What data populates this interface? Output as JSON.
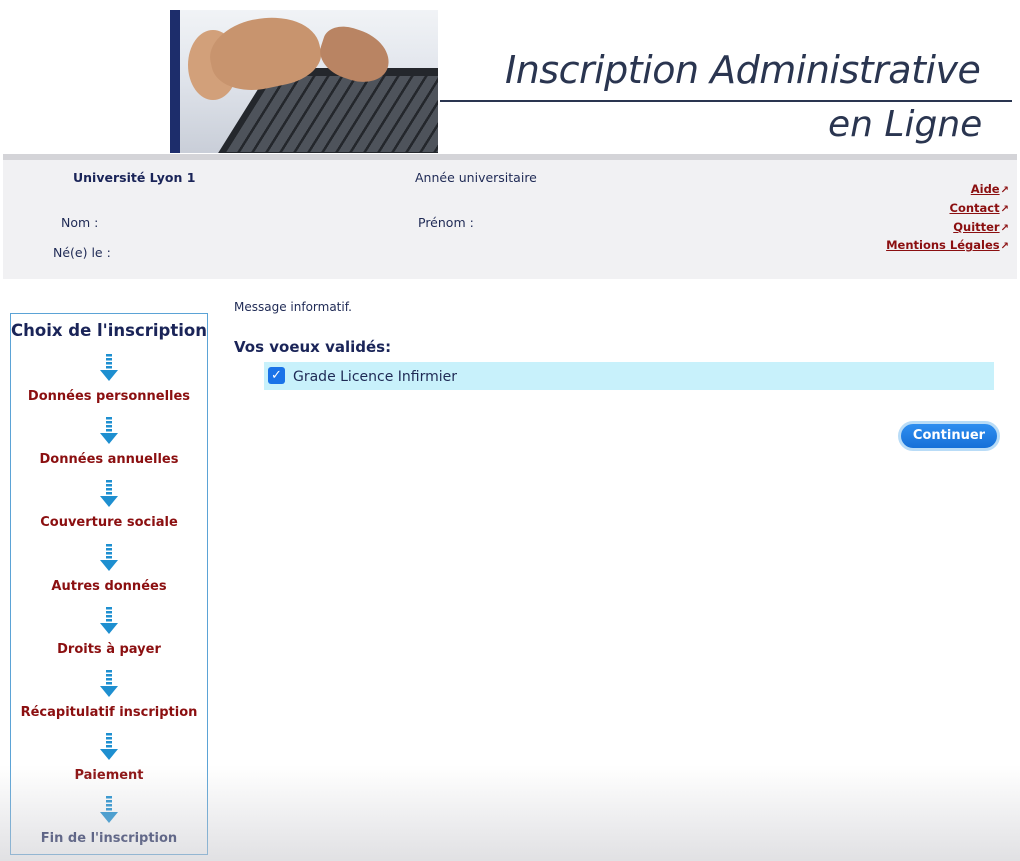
{
  "banner": {
    "title_line1": "Inscription Administrative",
    "title_line2": "en Ligne"
  },
  "info": {
    "university": "Université Lyon 1",
    "annee_label": "Année universitaire",
    "nom_label": "Nom :",
    "prenom_label": "Prénom :",
    "ne_le_label": "Né(e) le :"
  },
  "links": {
    "aide": "Aide",
    "contact": "Contact",
    "quitter": "Quitter",
    "mentions": "Mentions Légales",
    "external_glyph": "↗"
  },
  "sidebar": {
    "title": "Choix de l'inscription",
    "steps": [
      "Données personnelles",
      "Données annuelles",
      "Couverture sociale",
      "Autres données",
      "Droits à payer",
      "Récapitulatif inscription",
      "Paiement",
      "Fin de l'inscription"
    ]
  },
  "main": {
    "message": "Message informatif.",
    "voeux_heading": "Vos voeux validés:",
    "voeux": [
      {
        "label": "Grade Licence Infirmier",
        "checked": true
      }
    ],
    "continue_label": "Continuer"
  },
  "colors": {
    "accent_blue": "#1a73e8",
    "link_red": "#8b0f10",
    "navy": "#1a2458",
    "row_highlight": "#c8f1fb"
  },
  "icons": {
    "step_arrow": "arrow-down-icon",
    "checkbox": "checkbox-checked-icon",
    "external": "external-link-icon"
  }
}
